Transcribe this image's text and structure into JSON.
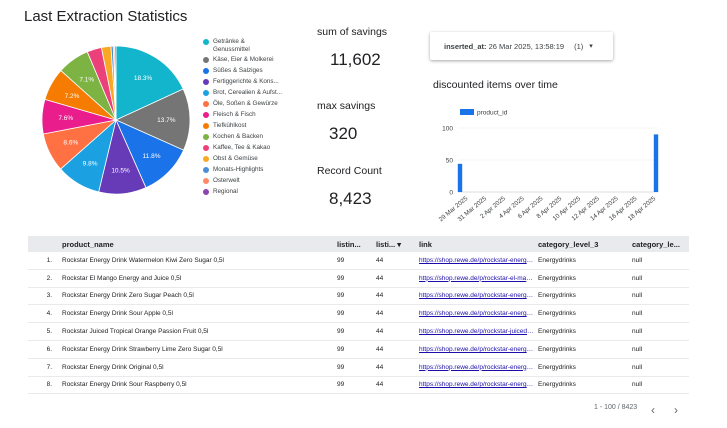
{
  "page_title": "Last Extraction Statistics",
  "pie": {
    "slices": [
      {
        "label": "Getränke & Genussmittel",
        "value": 18.3,
        "color": "#12b5cb",
        "pct": "18.3%"
      },
      {
        "label": "Käse, Eier & Molkerei",
        "value": 13.7,
        "color": "#757575",
        "pct": "13.7%"
      },
      {
        "label": "Süßes & Salziges",
        "value": 11.8,
        "color": "#1a73e8",
        "pct": "11.8%"
      },
      {
        "label": "Fertiggerichte & Konserven",
        "value": 10.5,
        "color": "#673ab7",
        "pct": "10.5%"
      },
      {
        "label": "Brot, Cerealien & Aufstriche",
        "value": 9.8,
        "color": "#1ba1e2",
        "pct": "9.8%"
      },
      {
        "label": "Öle, Soßen & Gewürze",
        "value": 8.6,
        "color": "#ff7043",
        "pct": "8.6%"
      },
      {
        "label": "Fleisch & Fisch",
        "value": 7.6,
        "color": "#e91e8c",
        "pct": "7.6%"
      },
      {
        "label": "Tiefkühlkost",
        "value": 7.2,
        "color": "#f57c00",
        "pct": "7.2%"
      },
      {
        "label": "Kochen & Backen",
        "value": 7.1,
        "color": "#7cb342",
        "pct": "7.1%"
      },
      {
        "label": "Kaffee, Tee & Kakao",
        "value": 3.2,
        "color": "#ec407a",
        "pct": ""
      },
      {
        "label": "Obst & Gemüse",
        "value": 2.1,
        "color": "#f9a825",
        "pct": ""
      },
      {
        "label": "Monats-Highlights",
        "value": 0.5,
        "color": "#4a90d9",
        "pct": ""
      },
      {
        "label": "Osterwelt",
        "value": 0.3,
        "color": "#ff8a65",
        "pct": ""
      },
      {
        "label": "Regional",
        "value": 0.3,
        "color": "#8e44ad",
        "pct": ""
      }
    ],
    "legend": [
      {
        "label": "Getränke &",
        "label2": "Genussmittel",
        "color": "#12b5cb"
      },
      {
        "label": "Käse, Eier & Molkerei",
        "label2": "",
        "color": "#757575"
      },
      {
        "label": "Süßes & Salziges",
        "label2": "",
        "color": "#1a73e8"
      },
      {
        "label": "Fertiggerichte & Kons...",
        "label2": "",
        "color": "#673ab7"
      },
      {
        "label": "Brot, Cerealien & Aufst...",
        "label2": "",
        "color": "#1ba1e2"
      },
      {
        "label": "Öle, Soßen & Gewürze",
        "label2": "",
        "color": "#ff7043"
      },
      {
        "label": "Fleisch & Fisch",
        "label2": "",
        "color": "#e91e8c"
      },
      {
        "label": "Tiefkühlkost",
        "label2": "",
        "color": "#f57c00"
      },
      {
        "label": "Kochen & Backen",
        "label2": "",
        "color": "#7cb342"
      },
      {
        "label": "Kaffee, Tee & Kakao",
        "label2": "",
        "color": "#ec407a"
      },
      {
        "label": "Obst & Gemüse",
        "label2": "",
        "color": "#f9a825"
      },
      {
        "label": "Monats-Highlights",
        "label2": "",
        "color": "#4a90d9"
      },
      {
        "label": "Osterwelt",
        "label2": "",
        "color": "#ff8a65"
      },
      {
        "label": "Regional",
        "label2": "",
        "color": "#8e44ad"
      }
    ]
  },
  "kpis": {
    "savings_label": "sum of savings",
    "savings_value": "11,602",
    "max_label": "max savings",
    "max_value": "320",
    "count_label": "Record Count",
    "count_value": "8,423"
  },
  "filter": {
    "field": "inserted_at",
    "value": "26 Mar 2025, 13:58:19",
    "count": "(1)",
    "dropdown_glyph": "▾"
  },
  "chart_data": {
    "type": "bar",
    "title": "discounted items over time",
    "legend": "product_id",
    "color": "#1a73e8",
    "ylim": [
      0,
      100
    ],
    "yticks": [
      "100",
      "50",
      "0"
    ],
    "x_ticks": [
      "29 Mar 2025",
      "31 Mar 2025",
      "2 Apr 2025",
      "4 Apr 2025",
      "6 Apr 2025",
      "8 Apr 2025",
      "10 Apr 2025",
      "12 Apr 2025",
      "14 Apr 2025",
      "16 Apr 2025",
      "18 Apr 2025"
    ],
    "bars": [
      {
        "x": "2025-03-27",
        "value": 44
      },
      {
        "x": "2025-04-19",
        "value": 90
      }
    ]
  },
  "table": {
    "columns": [
      "",
      "product_name",
      "listin...",
      "listi... ▾",
      "link",
      "category_level_3",
      "category_le..."
    ],
    "rows": [
      [
        "1.",
        "Rockstar Energy Drink Watermelon Kiwi Zero Sugar 0,5l",
        "99",
        "44",
        "https://shop.rewe.de/p/rockstar-energy-drink-watermelon",
        "Energydrinks",
        "null"
      ],
      [
        "2.",
        "Rockstar El Mango Energy and Juice 0,5l",
        "99",
        "44",
        "https://shop.rewe.de/p/rockstar-el-mango",
        "Energydrinks",
        "null"
      ],
      [
        "3.",
        "Rockstar Energy Drink Zero Sugar Peach 0,5l",
        "99",
        "44",
        "https://shop.rewe.de/p/rockstar-energy-drink-zero",
        "Energydrinks",
        "null"
      ],
      [
        "4.",
        "Rockstar Energy Drink Sour Apple 0,5l",
        "99",
        "44",
        "https://shop.rewe.de/p/rockstar-energy-drink-sour",
        "Energydrinks",
        "null"
      ],
      [
        "5.",
        "Rockstar Juiced Tropical Orange Passion Fruit 0,5l",
        "99",
        "44",
        "https://shop.rewe.de/p/rockstar-juiced-tropical",
        "Energydrinks",
        "null"
      ],
      [
        "6.",
        "Rockstar Energy Drink Strawberry Lime Zero Sugar 0,5l",
        "99",
        "44",
        "https://shop.rewe.de/p/rockstar-energy-drink-strawberry",
        "Energydrinks",
        "null"
      ],
      [
        "7.",
        "Rockstar Energy Drink Original 0,5l",
        "99",
        "44",
        "https://shop.rewe.de/p/rockstar-energy-drink-original",
        "Energydrinks",
        "null"
      ],
      [
        "8.",
        "Rockstar Energy Drink Sour Raspberry 0,5l",
        "99",
        "44",
        "https://shop.rewe.de/p/rockstar-energy-drink-raspberry",
        "Energydrinks",
        "null"
      ]
    ]
  },
  "pagination": {
    "text": "1 - 100 / 8423",
    "prev": "‹",
    "next": "›"
  }
}
